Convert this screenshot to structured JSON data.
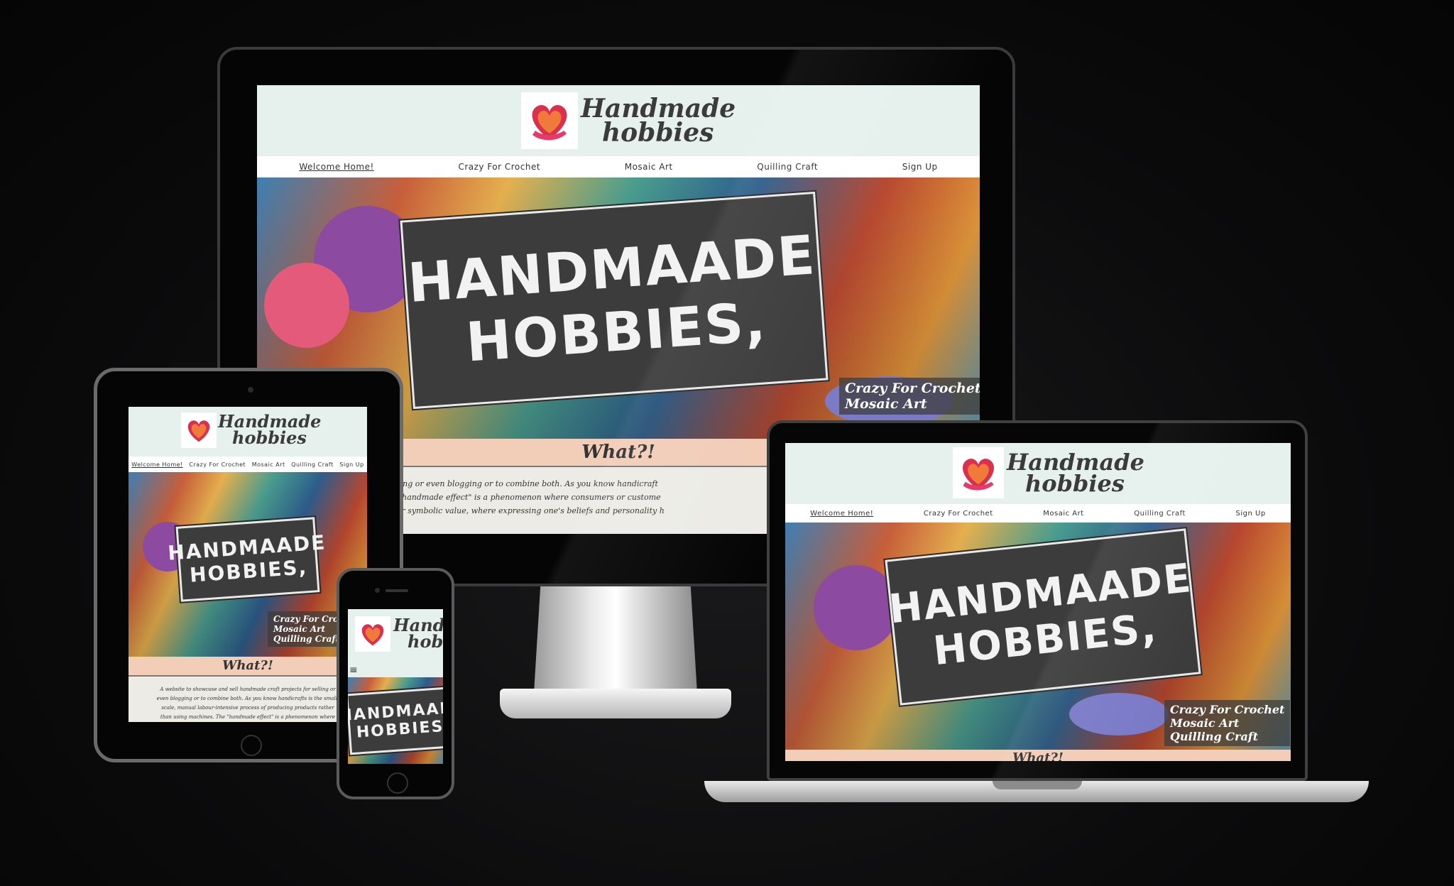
{
  "site": {
    "logo_line1": "Handmade",
    "logo_line2": "hobbies",
    "nav": [
      "Welcome Home!",
      "Crazy For Crochet",
      "Mosaic Art",
      "Quilling Craft",
      "Sign Up"
    ],
    "hero_sign_line1": "HANDMAADE",
    "hero_sign_line2": "HOBBIES,",
    "overlay_links": [
      "Crazy For Crochet",
      "Mosaic Art",
      "Quilling Craft"
    ],
    "section_title": "What?!",
    "body_lines_monitor": [
      "sell handmade craft projects for selling or even blogging or to combine both. As you know handicraft",
      "ts rather than using machines. The \"handmade effect\" is a phenomenon where consumers or custome",
      "ndmade products always have higher symbolic value, where expressing one's beliefs and personality h"
    ],
    "body_lines_tablet": [
      "A website to showcase and sell handmade craft projects for selling or",
      "even blogging or to combine both. As you know handicrafts is the small-",
      "scale, manual labour-intensive process of producing products rather",
      "than using machines. The \"handmade effect\" is a phenomenon where"
    ],
    "menu_icon": "hamburger-icon",
    "colors": {
      "header_bg": "#e6f1ee",
      "nav_bg": "#ffffff",
      "what_bar_bg": "#f2cdb8",
      "body_bg": "#ecebe6",
      "sign_bg": "#3c3c3c"
    }
  }
}
